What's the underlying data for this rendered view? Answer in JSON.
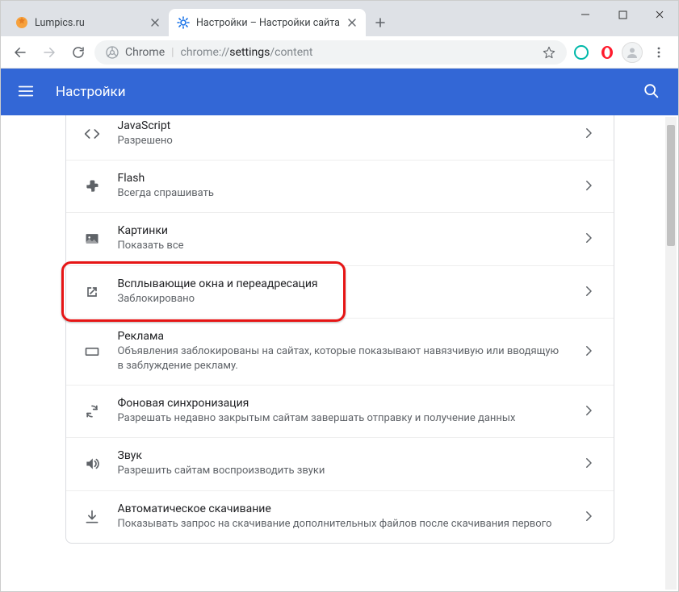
{
  "window": {
    "tabs": [
      {
        "title": "Lumpics.ru",
        "active": false
      },
      {
        "title": "Настройки – Настройки сайта",
        "active": true
      }
    ]
  },
  "toolbar": {
    "chrome_label": "Chrome",
    "url_prefix": "chrome://",
    "url_strong": "settings",
    "url_suffix": "/content"
  },
  "app": {
    "title": "Настройки"
  },
  "settings": [
    {
      "key": "javascript",
      "icon": "code-icon",
      "title": "JavaScript",
      "sub": "Разрешено"
    },
    {
      "key": "flash",
      "icon": "puzzle-icon",
      "title": "Flash",
      "sub": "Всегда спрашивать"
    },
    {
      "key": "images",
      "icon": "image-icon",
      "title": "Картинки",
      "sub": "Показать все"
    },
    {
      "key": "popups",
      "icon": "launch-icon",
      "title": "Всплывающие окна и переадресация",
      "sub": "Заблокировано",
      "highlight": true
    },
    {
      "key": "ads",
      "icon": "rectangle-icon",
      "title": "Реклама",
      "sub": "Объявления заблокированы на сайтах, которые показывают навязчивую или вводящую в заблуждение рекламу."
    },
    {
      "key": "sync",
      "icon": "sync-icon",
      "title": "Фоновая синхронизация",
      "sub": "Разрешать недавно закрытым сайтам завершать отправку и получение данных"
    },
    {
      "key": "sound",
      "icon": "sound-icon",
      "title": "Звук",
      "sub": "Разрешить сайтам воспроизводить звуки"
    },
    {
      "key": "downloads",
      "icon": "download-icon",
      "title": "Автоматическое скачивание",
      "sub": "Показывать запрос на скачивание дополнительных файлов после скачивания первого"
    }
  ]
}
